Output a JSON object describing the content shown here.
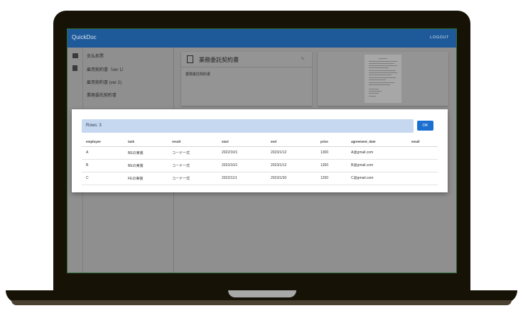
{
  "app": {
    "title": "QuickDoc",
    "logout_label": "LOGOUT"
  },
  "sidebar": {
    "items": [
      {
        "label": "支払担票",
        "icon": "folder-icon"
      },
      {
        "label": "雇用契約書（ver 1）",
        "icon": "document-icon"
      },
      {
        "label": "雇用契約書 (ver 2)",
        "icon": ""
      },
      {
        "label": "業務委託契約書",
        "icon": ""
      }
    ]
  },
  "main": {
    "cards": [
      {
        "title": "業務委託契約書",
        "body": "業務委託契約書"
      }
    ]
  },
  "dialog": {
    "rows_label": "Rows: 3",
    "ok_label": "OK",
    "columns": [
      "employee",
      "task",
      "result",
      "start",
      "end",
      "price",
      "agreement_date",
      "email"
    ],
    "rows": [
      [
        "A",
        "BEの実装",
        "コード一式",
        "2022/10/1",
        "2023/1/12",
        "1300",
        "A@gmail.com",
        ""
      ],
      [
        "B",
        "BEの実装",
        "コード一式",
        "2022/10/1",
        "2023/1/12",
        "1300",
        "B@gmail.com",
        ""
      ],
      [
        "C",
        "FEの実装",
        "コード一式",
        "2022/11/1",
        "2023/1/30",
        "1200",
        "C@gmail.com",
        ""
      ]
    ]
  },
  "colors": {
    "appbar": "#1e5a9a",
    "accent": "#1a6fd0",
    "rows_bar": "#c5d8f0"
  }
}
